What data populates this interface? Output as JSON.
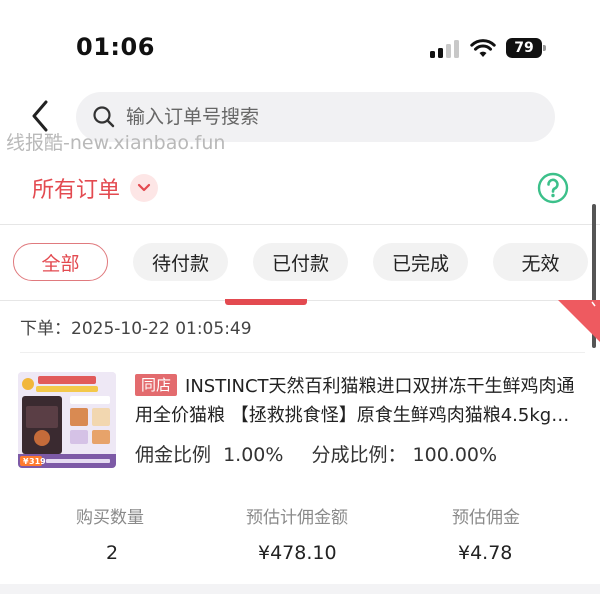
{
  "status_bar": {
    "time": "01:06",
    "battery": "79"
  },
  "search": {
    "placeholder": "输入订单号搜索"
  },
  "watermark": "线报酷-new.xianbao.fun",
  "filter": {
    "label": "所有订单"
  },
  "tabs": [
    {
      "label": "全部",
      "active": true
    },
    {
      "label": "待付款",
      "active": false
    },
    {
      "label": "已付款",
      "active": false
    },
    {
      "label": "已完成",
      "active": false
    },
    {
      "label": "无效",
      "active": false
    }
  ],
  "order": {
    "time_label": "下单：",
    "time_value": "2025-10-22 01:05:49",
    "store_badge": "同店",
    "title": "INSTINCT天然百利猫粮进口双拼冻干生鲜鸡肉通用全价猫粮 【拯救挑食怪】原食生鲜鸡肉猫粮4.5kg…",
    "commission_ratio_label": "佣金比例",
    "commission_ratio_value": "1.00%",
    "share_ratio_label": "分成比例：",
    "share_ratio_value": "100.00%",
    "stats": [
      {
        "label": "购买数量",
        "value": "2"
      },
      {
        "label": "预估计佣金额",
        "value": "¥478.10"
      },
      {
        "label": "预估佣金",
        "value": "¥4.78"
      }
    ],
    "thumb_price": "319"
  },
  "colors": {
    "accent": "#e34a50",
    "ribbon": "#ee5a60",
    "help_green": "#3cc08a"
  }
}
